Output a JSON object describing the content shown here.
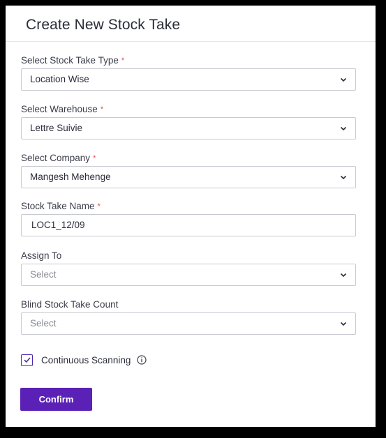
{
  "dialog": {
    "title": "Create New Stock Take",
    "required_marker": "*"
  },
  "form": {
    "stock_take_type": {
      "label": "Select Stock Take Type",
      "value": "Location Wise",
      "required": true
    },
    "warehouse": {
      "label": "Select Warehouse",
      "value": "Lettre Suivie",
      "required": true
    },
    "company": {
      "label": "Select Company",
      "value": "Mangesh Mehenge",
      "required": true
    },
    "stock_take_name": {
      "label": "Stock Take Name",
      "value": "LOC1_12/09",
      "required": true
    },
    "assign_to": {
      "label": "Assign To",
      "placeholder": "Select",
      "required": false
    },
    "blind_count": {
      "label": "Blind Stock Take Count",
      "placeholder": "Select",
      "required": false
    },
    "continuous_scanning": {
      "label": "Continuous Scanning",
      "checked": true,
      "info_icon": "info-icon"
    }
  },
  "actions": {
    "confirm_label": "Confirm"
  },
  "colors": {
    "accent": "#5b21b6",
    "required": "#e5484d",
    "checkbox": "#4b2aa8"
  }
}
